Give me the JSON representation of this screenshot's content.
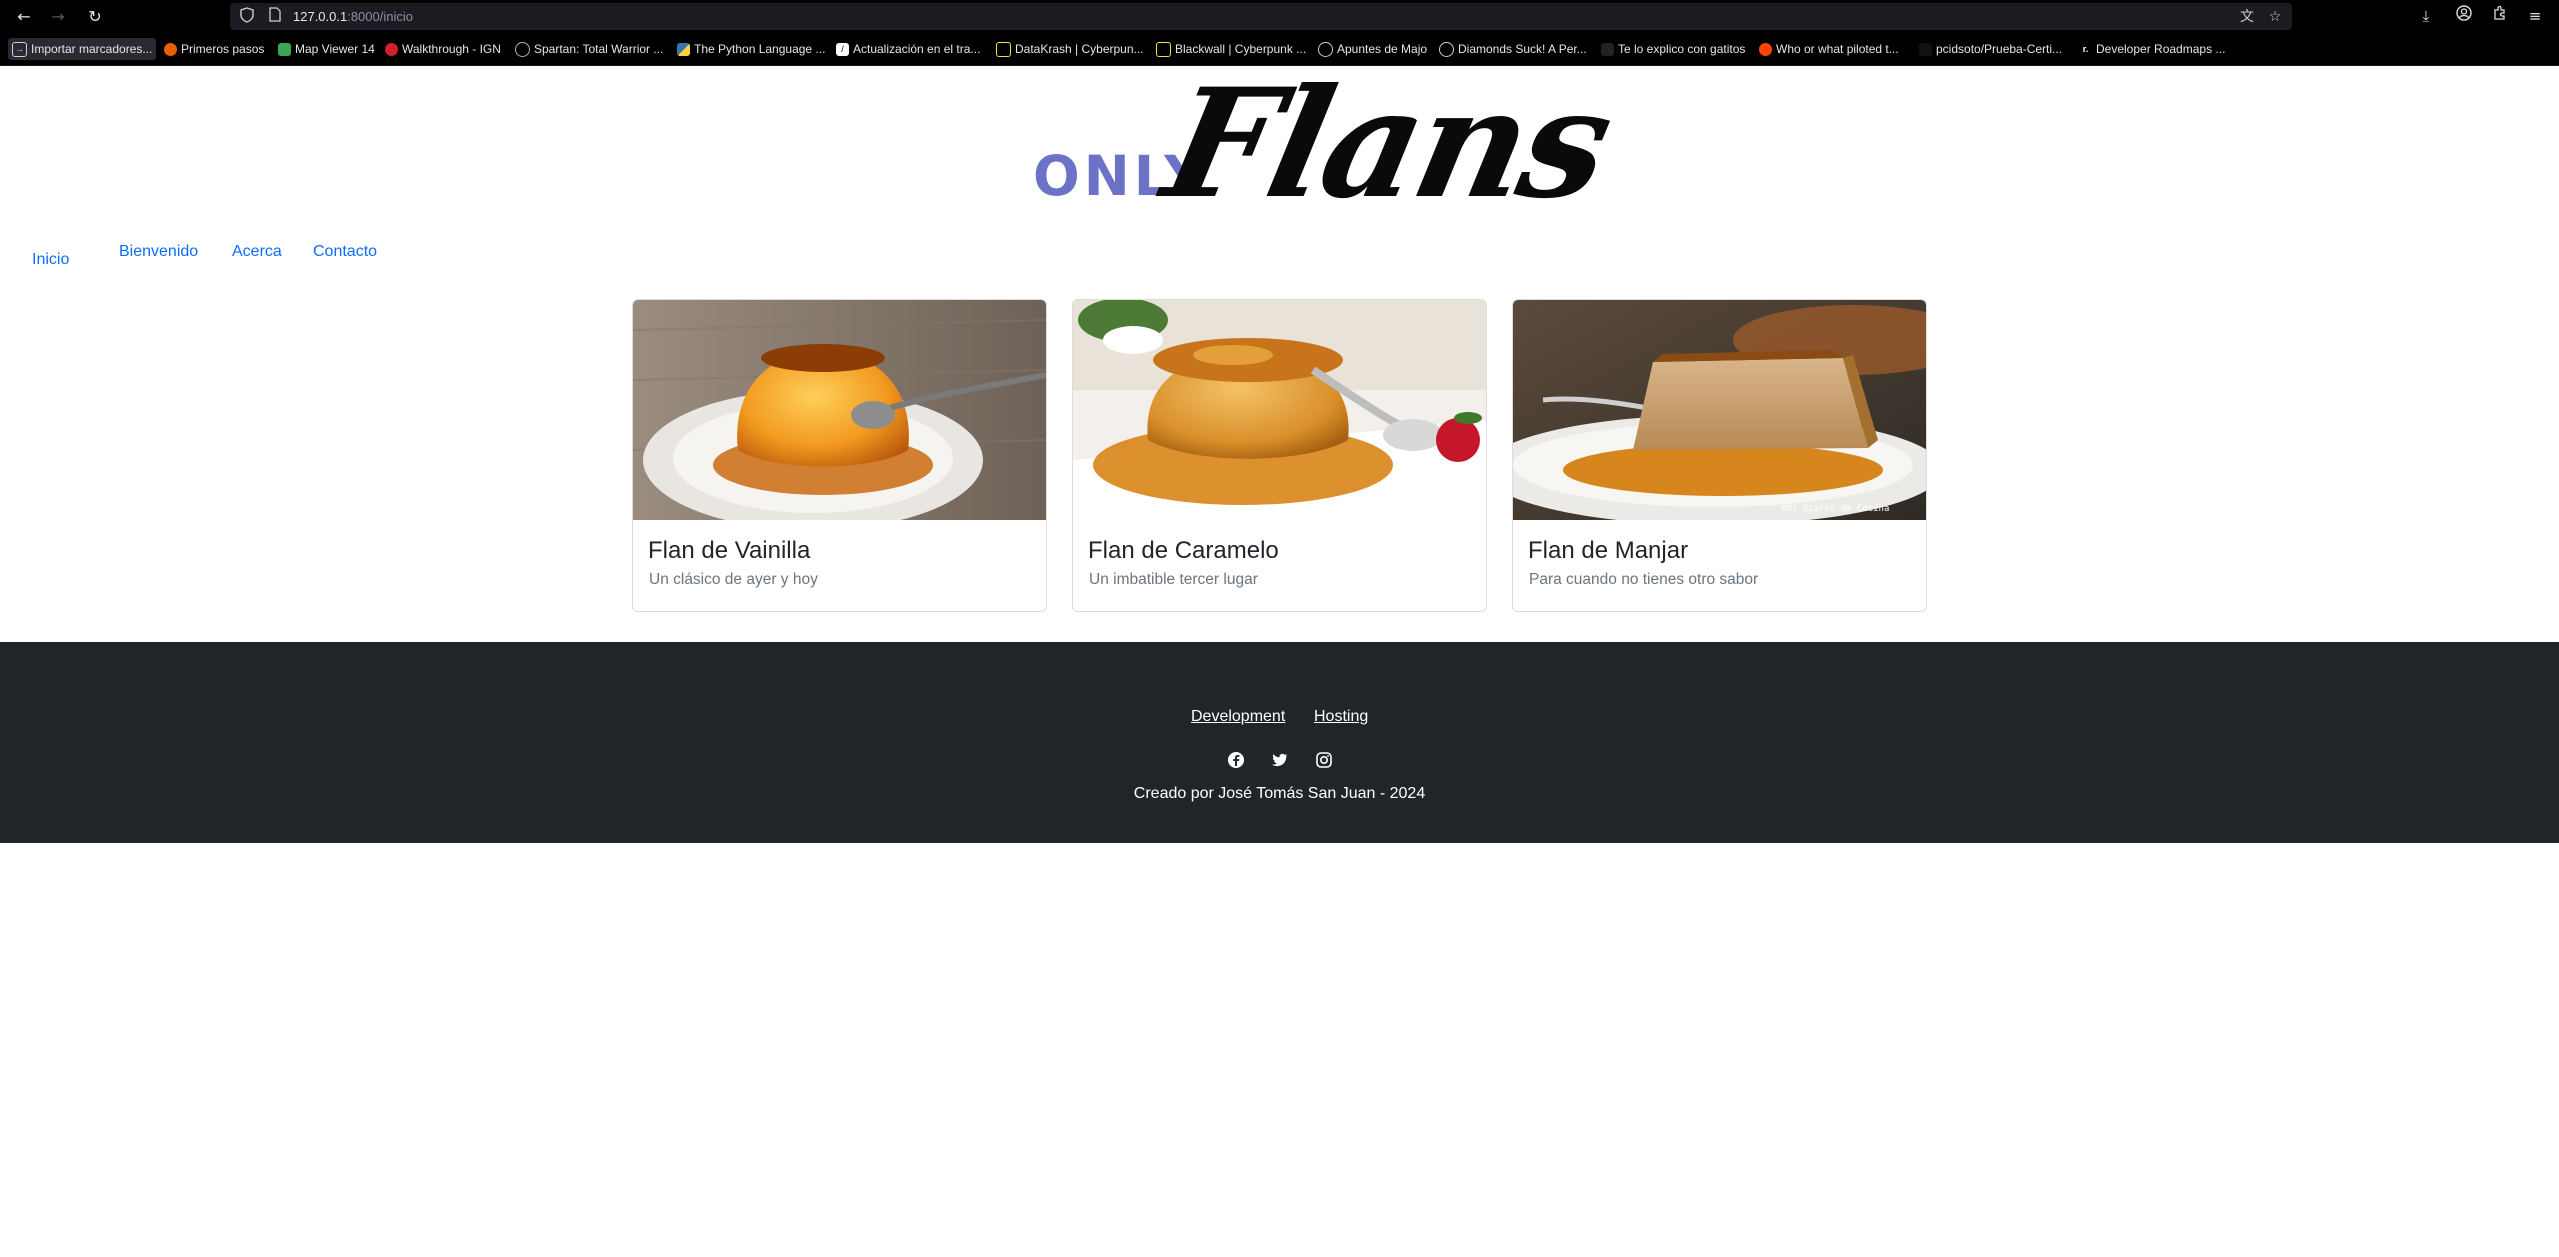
{
  "browser": {
    "url_host": "127.0.0.1",
    "url_path": ":8000/inicio",
    "bookmarks": [
      {
        "label": "Importar marcadores...",
        "icon": "import-icon"
      },
      {
        "label": "Primeros pasos",
        "icon": "firefox-icon"
      },
      {
        "label": "Map Viewer 14",
        "icon": "map-icon"
      },
      {
        "label": "Walkthrough - IGN",
        "icon": "ign-icon"
      },
      {
        "label": "Spartan: Total Warrior ...",
        "icon": "globe-icon"
      },
      {
        "label": "The Python Language ...",
        "icon": "python-icon"
      },
      {
        "label": "Actualización en el tra...",
        "icon": "page-icon"
      },
      {
        "label": "DataKrash | Cyberpun...",
        "icon": "cyberpunk-icon"
      },
      {
        "label": "Blackwall | Cyberpunk ...",
        "icon": "cyberpunk-icon"
      },
      {
        "label": "Apuntes de Majo",
        "icon": "globe-icon"
      },
      {
        "label": "Diamonds Suck! A Per...",
        "icon": "globe-icon"
      },
      {
        "label": "Te lo explico con gatitos",
        "icon": "blank-icon"
      },
      {
        "label": "Who or what piloted t...",
        "icon": "reddit-icon"
      },
      {
        "label": "pcidsoto/Prueba-Certi...",
        "icon": "blank-icon"
      },
      {
        "label": "Developer Roadmaps ...",
        "icon": "roadmap-icon"
      }
    ]
  },
  "logo": {
    "only": "ONLY",
    "flans": "Flans"
  },
  "nav": {
    "inicio": "Inicio",
    "bienvenido": "Bienvenido",
    "acerca": "Acerca",
    "contacto": "Contacto"
  },
  "cards": [
    {
      "title": "Flan de Vainilla",
      "text": "Un clásico de ayer y hoy"
    },
    {
      "title": "Flan de Caramelo",
      "text": "Un imbatible tercer lugar"
    },
    {
      "title": "Flan de Manjar",
      "text": "Para cuando no tienes otro sabor",
      "watermark": "©Mi Diario de Cocina"
    }
  ],
  "footer": {
    "links": [
      "Development",
      "Hosting"
    ],
    "social": [
      "facebook-icon",
      "twitter-icon",
      "instagram-icon"
    ],
    "credit": "Creado por José Tomás San Juan - 2024"
  },
  "colors": {
    "brand": "#6c73c7",
    "link": "#0d6efd",
    "footer_bg": "#212529"
  }
}
